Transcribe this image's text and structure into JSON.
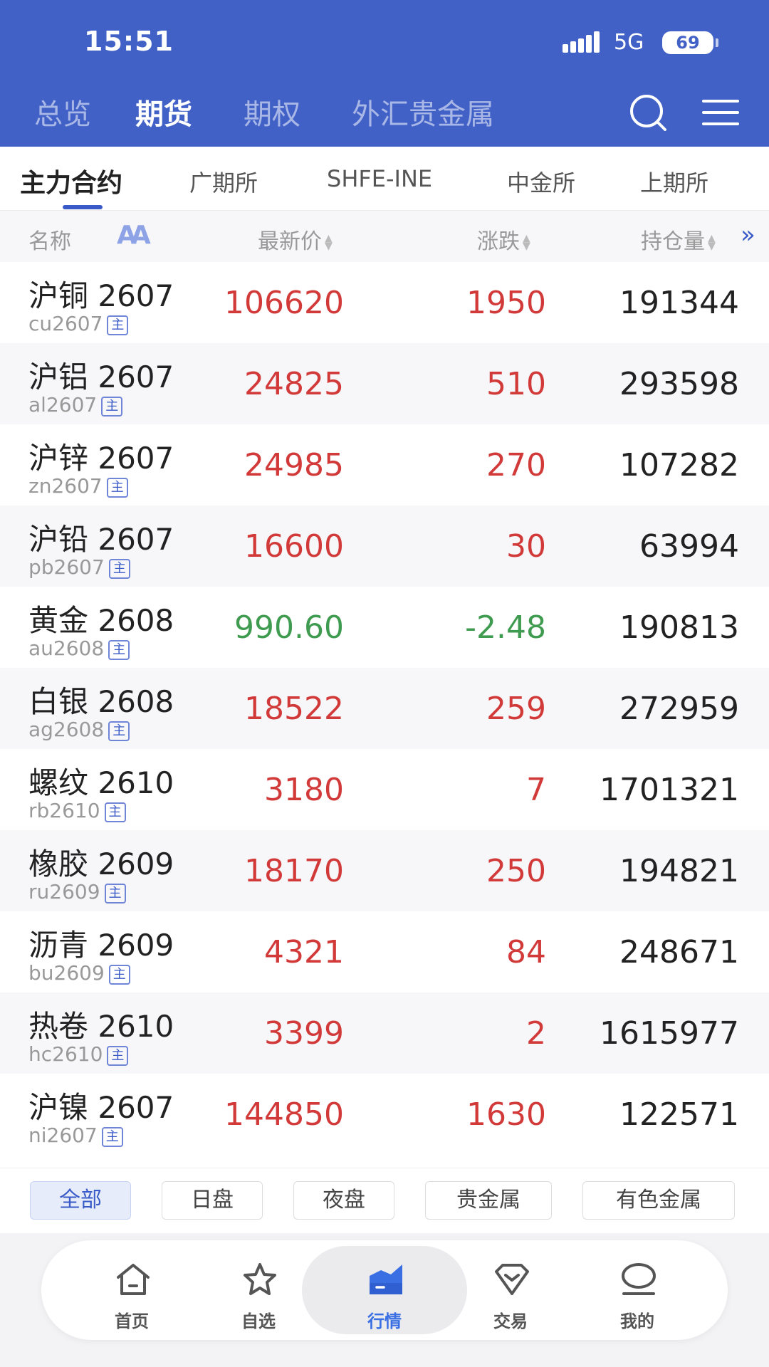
{
  "status_bar": {
    "time": "15:51",
    "network": "5G",
    "battery": "69"
  },
  "main_tabs": [
    {
      "label": "总览",
      "active": false
    },
    {
      "label": "期货",
      "active": true
    },
    {
      "label": "期权",
      "active": false
    },
    {
      "label": "外汇贵金属",
      "active": false
    }
  ],
  "sub_tabs": [
    {
      "label": "主力合约",
      "active": true
    },
    {
      "label": "广期所",
      "active": false
    },
    {
      "label": "SHFE-INE",
      "active": false
    },
    {
      "label": "中金所",
      "active": false
    },
    {
      "label": "上期所",
      "active": false
    }
  ],
  "columns": {
    "name": "名称",
    "price": "最新价",
    "change": "涨跌",
    "open_interest": "持仓量"
  },
  "font_size_toggle": "AA",
  "main_badge": "主",
  "colors": {
    "up": "#d23a3a",
    "down": "#3e9b4f",
    "accent": "#3a5bc7",
    "header": "#4161c7"
  },
  "rows": [
    {
      "name": "沪铜 2607",
      "code": "cu2607",
      "price": "106620",
      "change": "1950",
      "oi": "191344",
      "dir": "up"
    },
    {
      "name": "沪铝 2607",
      "code": "al2607",
      "price": "24825",
      "change": "510",
      "oi": "293598",
      "dir": "up"
    },
    {
      "name": "沪锌 2607",
      "code": "zn2607",
      "price": "24985",
      "change": "270",
      "oi": "107282",
      "dir": "up"
    },
    {
      "name": "沪铅 2607",
      "code": "pb2607",
      "price": "16600",
      "change": "30",
      "oi": "63994",
      "dir": "up"
    },
    {
      "name": "黄金 2608",
      "code": "au2608",
      "price": "990.60",
      "change": "-2.48",
      "oi": "190813",
      "dir": "down"
    },
    {
      "name": "白银 2608",
      "code": "ag2608",
      "price": "18522",
      "change": "259",
      "oi": "272959",
      "dir": "up"
    },
    {
      "name": "螺纹 2610",
      "code": "rb2610",
      "price": "3180",
      "change": "7",
      "oi": "1701321",
      "dir": "up"
    },
    {
      "name": "橡胶 2609",
      "code": "ru2609",
      "price": "18170",
      "change": "250",
      "oi": "194821",
      "dir": "up"
    },
    {
      "name": "沥青 2609",
      "code": "bu2609",
      "price": "4321",
      "change": "84",
      "oi": "248671",
      "dir": "up"
    },
    {
      "name": "热卷 2610",
      "code": "hc2610",
      "price": "3399",
      "change": "2",
      "oi": "1615977",
      "dir": "up"
    },
    {
      "name": "沪镍 2607",
      "code": "ni2607",
      "price": "144850",
      "change": "1630",
      "oi": "122571",
      "dir": "up"
    }
  ],
  "filters": [
    {
      "label": "全部",
      "active": true
    },
    {
      "label": "日盘",
      "active": false
    },
    {
      "label": "夜盘",
      "active": false
    },
    {
      "label": "贵金属",
      "active": false
    },
    {
      "label": "有色金属",
      "active": false
    }
  ],
  "bottom_nav": [
    {
      "label": "首页",
      "icon": "home-icon",
      "active": false
    },
    {
      "label": "自选",
      "icon": "star-icon",
      "active": false
    },
    {
      "label": "行情",
      "icon": "market-chart-icon",
      "active": true
    },
    {
      "label": "交易",
      "icon": "diamond-icon",
      "active": false
    },
    {
      "label": "我的",
      "icon": "profile-icon",
      "active": false
    }
  ]
}
